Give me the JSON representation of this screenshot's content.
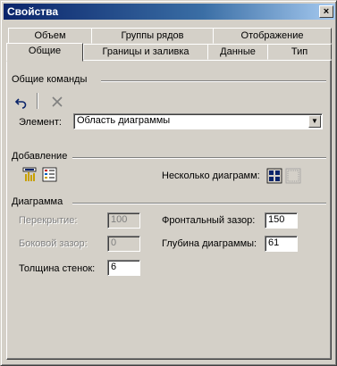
{
  "window": {
    "title": "Свойства",
    "close_glyph": "×"
  },
  "tabs_back": [
    "Объем",
    "Группы рядов",
    "Отображение"
  ],
  "tabs_front": [
    "Общие",
    "Границы и заливка",
    "Данные",
    "Тип"
  ],
  "active_tab": "Общие",
  "general": {
    "header": "Общие команды",
    "element_label": "Элемент:",
    "element_value": "Область диаграммы",
    "undo_icon": "undo-icon",
    "delete_icon": "delete-icon"
  },
  "add": {
    "header": "Добавление",
    "multiple_label": "Несколько диаграмм:"
  },
  "chart": {
    "header": "Диаграмма",
    "overlap_label": "Перекрытие:",
    "overlap_value": "100",
    "side_gap_label": "Боковой зазор:",
    "side_gap_value": "0",
    "wall_label": "Толщина стенок:",
    "wall_value": "6",
    "front_gap_label": "Фронтальный зазор:",
    "front_gap_value": "150",
    "depth_label": "Глубина диаграммы:",
    "depth_value": "61"
  }
}
